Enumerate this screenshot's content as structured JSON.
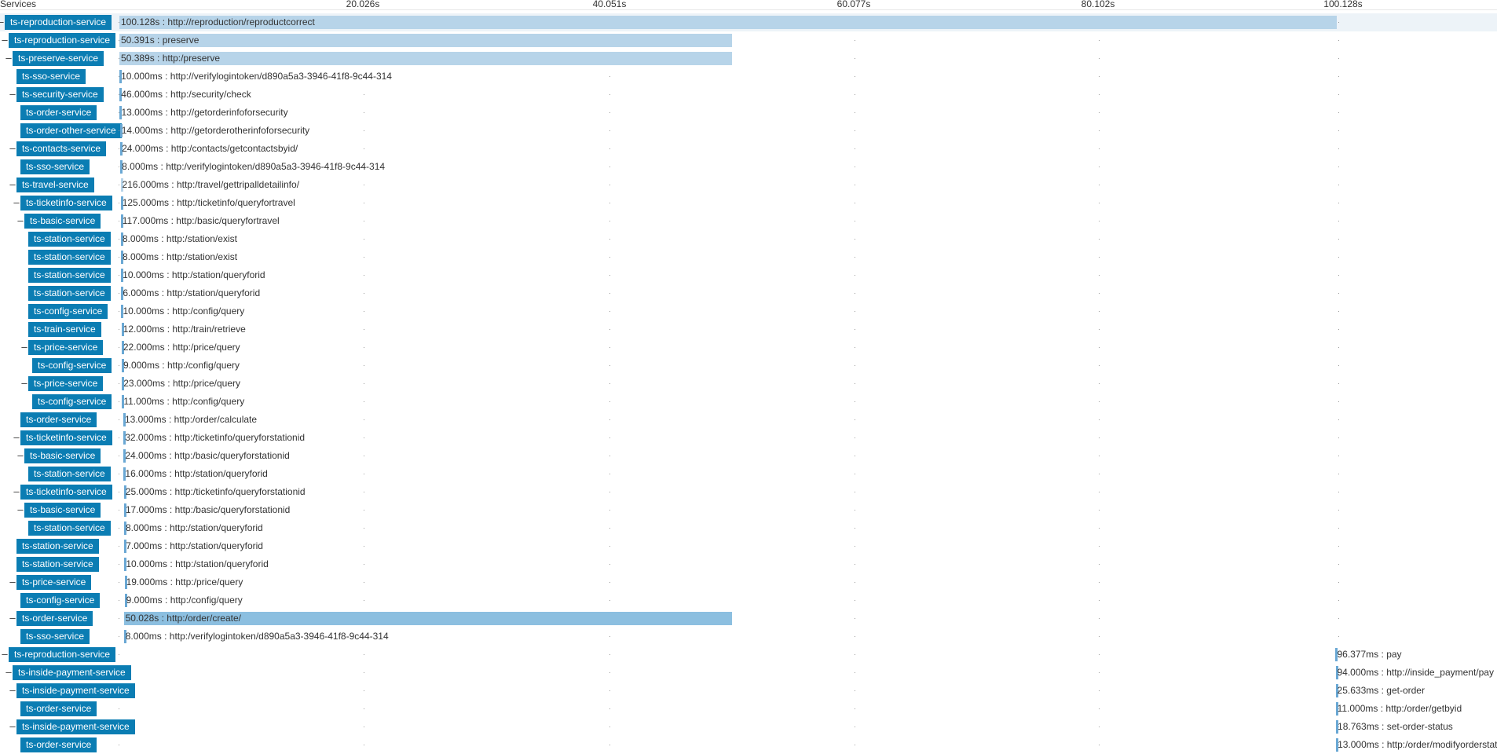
{
  "header": {
    "services_label": "Services",
    "ticks": [
      "20.026s",
      "40.051s",
      "60.077s",
      "80.102s",
      "100.128s"
    ]
  },
  "colors": {
    "service_badge": "#0b7db3",
    "bar_light": "#b7d4e9",
    "bar_dark": "#8cbfe0",
    "row_highlight": "#edf3f8"
  },
  "spans": [
    {
      "service": "ts-reproduction-service",
      "duration": "100.128s",
      "name": "http://reproduction/reproductcorrect",
      "start_s": 0,
      "dur_s": 100.128,
      "depth": 0,
      "collapsible": true
    },
    {
      "service": "ts-reproduction-service",
      "duration": "50.391s",
      "name": "preserve",
      "start_s": 0,
      "dur_s": 50.391,
      "depth": 1,
      "collapsible": true
    },
    {
      "service": "ts-preserve-service",
      "duration": "50.389s",
      "name": "http:/preserve",
      "start_s": 0.002,
      "dur_s": 50.389,
      "depth": 2,
      "collapsible": true
    },
    {
      "service": "ts-sso-service",
      "duration": "10.000ms",
      "name": "http://verifylogintoken/d890a5a3-3946-41f8-9c44-314",
      "start_s": 0.005,
      "dur_s": 0.01,
      "depth": 3,
      "collapsible": false
    },
    {
      "service": "ts-security-service",
      "duration": "46.000ms",
      "name": "http:/security/check",
      "start_s": 0.02,
      "dur_s": 0.046,
      "depth": 3,
      "collapsible": true
    },
    {
      "service": "ts-order-service",
      "duration": "13.000ms",
      "name": "http://getorderinfoforsecurity",
      "start_s": 0.03,
      "dur_s": 0.013,
      "depth": 4,
      "collapsible": false
    },
    {
      "service": "ts-order-other-service",
      "duration": "14.000ms",
      "name": "http://getorderotherinfoforsecurity",
      "start_s": 0.045,
      "dur_s": 0.014,
      "depth": 4,
      "collapsible": false
    },
    {
      "service": "ts-contacts-service",
      "duration": "24.000ms",
      "name": "http:/contacts/getcontactsbyid/",
      "start_s": 0.07,
      "dur_s": 0.024,
      "depth": 3,
      "collapsible": true
    },
    {
      "service": "ts-sso-service",
      "duration": "8.000ms",
      "name": "http:/verifylogintoken/d890a5a3-3946-41f8-9c44-314",
      "start_s": 0.075,
      "dur_s": 0.008,
      "depth": 4,
      "collapsible": false
    },
    {
      "service": "ts-travel-service",
      "duration": "216.000ms",
      "name": "http:/travel/gettripalldetailinfo/",
      "start_s": 0.1,
      "dur_s": 0.216,
      "depth": 3,
      "collapsible": true
    },
    {
      "service": "ts-ticketinfo-service",
      "duration": "125.000ms",
      "name": "http:/ticketinfo/queryfortravel",
      "start_s": 0.11,
      "dur_s": 0.125,
      "depth": 4,
      "collapsible": true
    },
    {
      "service": "ts-basic-service",
      "duration": "117.000ms",
      "name": "http:/basic/queryfortravel",
      "start_s": 0.115,
      "dur_s": 0.117,
      "depth": 5,
      "collapsible": true
    },
    {
      "service": "ts-station-service",
      "duration": "8.000ms",
      "name": "http:/station/exist",
      "start_s": 0.12,
      "dur_s": 0.008,
      "depth": 6,
      "collapsible": false
    },
    {
      "service": "ts-station-service",
      "duration": "8.000ms",
      "name": "http:/station/exist",
      "start_s": 0.13,
      "dur_s": 0.008,
      "depth": 6,
      "collapsible": false
    },
    {
      "service": "ts-station-service",
      "duration": "10.000ms",
      "name": "http:/station/queryforid",
      "start_s": 0.14,
      "dur_s": 0.01,
      "depth": 6,
      "collapsible": false
    },
    {
      "service": "ts-station-service",
      "duration": "6.000ms",
      "name": "http:/station/queryforid",
      "start_s": 0.152,
      "dur_s": 0.006,
      "depth": 6,
      "collapsible": false
    },
    {
      "service": "ts-config-service",
      "duration": "10.000ms",
      "name": "http:/config/query",
      "start_s": 0.16,
      "dur_s": 0.01,
      "depth": 6,
      "collapsible": false
    },
    {
      "service": "ts-train-service",
      "duration": "12.000ms",
      "name": "http:/train/retrieve",
      "start_s": 0.172,
      "dur_s": 0.012,
      "depth": 6,
      "collapsible": false
    },
    {
      "service": "ts-price-service",
      "duration": "22.000ms",
      "name": "http:/price/query",
      "start_s": 0.186,
      "dur_s": 0.022,
      "depth": 6,
      "collapsible": true
    },
    {
      "service": "ts-config-service",
      "duration": "9.000ms",
      "name": "http:/config/query",
      "start_s": 0.19,
      "dur_s": 0.009,
      "depth": 7,
      "collapsible": false
    },
    {
      "service": "ts-price-service",
      "duration": "23.000ms",
      "name": "http:/price/query",
      "start_s": 0.21,
      "dur_s": 0.023,
      "depth": 6,
      "collapsible": true
    },
    {
      "service": "ts-config-service",
      "duration": "11.000ms",
      "name": "http:/config/query",
      "start_s": 0.215,
      "dur_s": 0.011,
      "depth": 7,
      "collapsible": false
    },
    {
      "service": "ts-order-service",
      "duration": "13.000ms",
      "name": "http:/order/calculate",
      "start_s": 0.32,
      "dur_s": 0.013,
      "depth": 4,
      "collapsible": false
    },
    {
      "service": "ts-ticketinfo-service",
      "duration": "32.000ms",
      "name": "http:/ticketinfo/queryforstationid",
      "start_s": 0.34,
      "dur_s": 0.032,
      "depth": 4,
      "collapsible": true
    },
    {
      "service": "ts-basic-service",
      "duration": "24.000ms",
      "name": "http:/basic/queryforstationid",
      "start_s": 0.345,
      "dur_s": 0.024,
      "depth": 5,
      "collapsible": true
    },
    {
      "service": "ts-station-service",
      "duration": "16.000ms",
      "name": "http:/station/queryforid",
      "start_s": 0.35,
      "dur_s": 0.016,
      "depth": 6,
      "collapsible": false
    },
    {
      "service": "ts-ticketinfo-service",
      "duration": "25.000ms",
      "name": "http:/ticketinfo/queryforstationid",
      "start_s": 0.375,
      "dur_s": 0.025,
      "depth": 4,
      "collapsible": true
    },
    {
      "service": "ts-basic-service",
      "duration": "17.000ms",
      "name": "http:/basic/queryforstationid",
      "start_s": 0.38,
      "dur_s": 0.017,
      "depth": 5,
      "collapsible": true
    },
    {
      "service": "ts-station-service",
      "duration": "8.000ms",
      "name": "http:/station/queryforid",
      "start_s": 0.385,
      "dur_s": 0.008,
      "depth": 6,
      "collapsible": false
    },
    {
      "service": "ts-station-service",
      "duration": "7.000ms",
      "name": "http:/station/queryforid",
      "start_s": 0.4,
      "dur_s": 0.007,
      "depth": 3,
      "collapsible": false
    },
    {
      "service": "ts-station-service",
      "duration": "10.000ms",
      "name": "http:/station/queryforid",
      "start_s": 0.41,
      "dur_s": 0.01,
      "depth": 3,
      "collapsible": false
    },
    {
      "service": "ts-price-service",
      "duration": "19.000ms",
      "name": "http:/price/query",
      "start_s": 0.425,
      "dur_s": 0.019,
      "depth": 3,
      "collapsible": true
    },
    {
      "service": "ts-config-service",
      "duration": "9.000ms",
      "name": "http:/config/query",
      "start_s": 0.43,
      "dur_s": 0.009,
      "depth": 4,
      "collapsible": false
    },
    {
      "service": "ts-order-service",
      "duration": "50.028s",
      "name": "http:/order/create/",
      "start_s": 0.36,
      "dur_s": 50.028,
      "depth": 3,
      "collapsible": true
    },
    {
      "service": "ts-sso-service",
      "duration": "8.000ms",
      "name": "http:/verifylogintoken/d890a5a3-3946-41f8-9c44-314",
      "start_s": 0.37,
      "dur_s": 0.008,
      "depth": 4,
      "collapsible": false
    },
    {
      "service": "ts-reproduction-service",
      "duration": "96.377ms",
      "name": "pay",
      "start_s": 100.03,
      "dur_s": 0.096,
      "depth": 1,
      "collapsible": true
    },
    {
      "service": "ts-inside-payment-service",
      "duration": "94.000ms",
      "name": "http://inside_payment/pay",
      "start_s": 100.032,
      "dur_s": 0.094,
      "depth": 2,
      "collapsible": true
    },
    {
      "service": "ts-inside-payment-service",
      "duration": "25.633ms",
      "name": "get-order",
      "start_s": 100.035,
      "dur_s": 0.026,
      "depth": 3,
      "collapsible": true
    },
    {
      "service": "ts-order-service",
      "duration": "11.000ms",
      "name": "http:/order/getbyid",
      "start_s": 100.037,
      "dur_s": 0.011,
      "depth": 4,
      "collapsible": false
    },
    {
      "service": "ts-inside-payment-service",
      "duration": "18.763ms",
      "name": "set-order-status",
      "start_s": 100.065,
      "dur_s": 0.019,
      "depth": 3,
      "collapsible": true
    },
    {
      "service": "ts-order-service",
      "duration": "13.000ms",
      "name": "http:/order/modifyorderstatus",
      "start_s": 100.068,
      "dur_s": 0.013,
      "depth": 4,
      "collapsible": false
    }
  ]
}
